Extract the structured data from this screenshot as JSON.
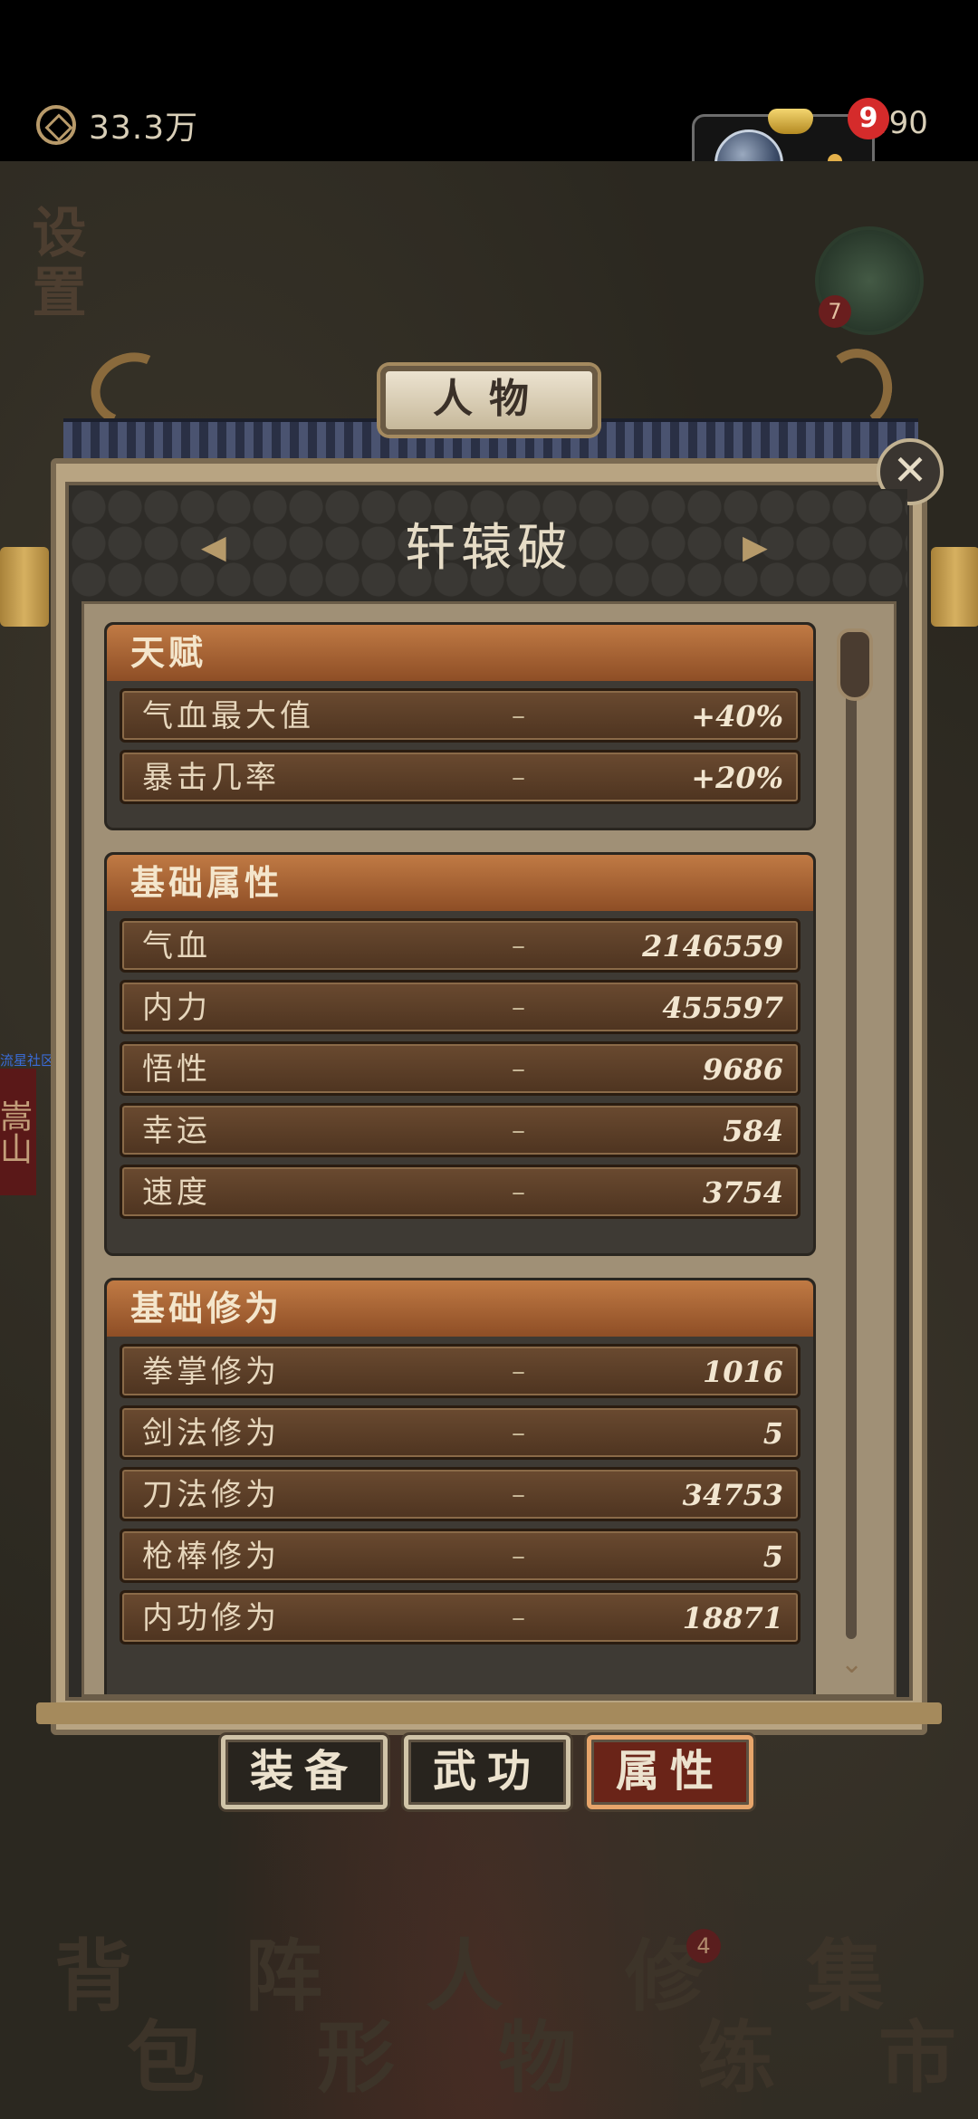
{
  "status": {
    "currency_text": "33.3万",
    "gold_text": "490",
    "notif_count": "9"
  },
  "map": {
    "settings_label": "设置",
    "side_badge": "7",
    "link_label": "流星社区",
    "side_tag": "嵩山"
  },
  "panel": {
    "title": "人物",
    "character_name": "轩辕破",
    "arrow_left": "◀",
    "arrow_right": "▶",
    "close": "✕"
  },
  "sections": [
    {
      "title": "天赋",
      "rows": [
        {
          "label": "气血最大值",
          "dash": "–",
          "value": "+40%"
        },
        {
          "label": "暴击几率",
          "dash": "–",
          "value": "+20%"
        }
      ]
    },
    {
      "title": "基础属性",
      "rows": [
        {
          "label": "气血",
          "dash": "–",
          "value": "2146559"
        },
        {
          "label": "内力",
          "dash": "–",
          "value": "455597"
        },
        {
          "label": "悟性",
          "dash": "–",
          "value": "9686"
        },
        {
          "label": "幸运",
          "dash": "–",
          "value": "584"
        },
        {
          "label": "速度",
          "dash": "–",
          "value": "3754"
        }
      ]
    },
    {
      "title": "基础修为",
      "rows": [
        {
          "label": "拳掌修为",
          "dash": "–",
          "value": "1016"
        },
        {
          "label": "剑法修为",
          "dash": "–",
          "value": "5"
        },
        {
          "label": "刀法修为",
          "dash": "–",
          "value": "34753"
        },
        {
          "label": "枪棒修为",
          "dash": "–",
          "value": "5"
        },
        {
          "label": "内功修为",
          "dash": "–",
          "value": "18871"
        }
      ]
    }
  ],
  "tabs": [
    {
      "label": "装备",
      "active": false
    },
    {
      "label": "武功",
      "active": false
    },
    {
      "label": "属性",
      "active": true
    }
  ],
  "nav": [
    {
      "c1": "背",
      "c2": "包"
    },
    {
      "c1": "阵",
      "c2": "形"
    },
    {
      "c1": "人",
      "c2": "物"
    },
    {
      "c1": "修",
      "c2": "练"
    },
    {
      "c1": "集",
      "c2": "市"
    }
  ],
  "nav_badge": "4"
}
